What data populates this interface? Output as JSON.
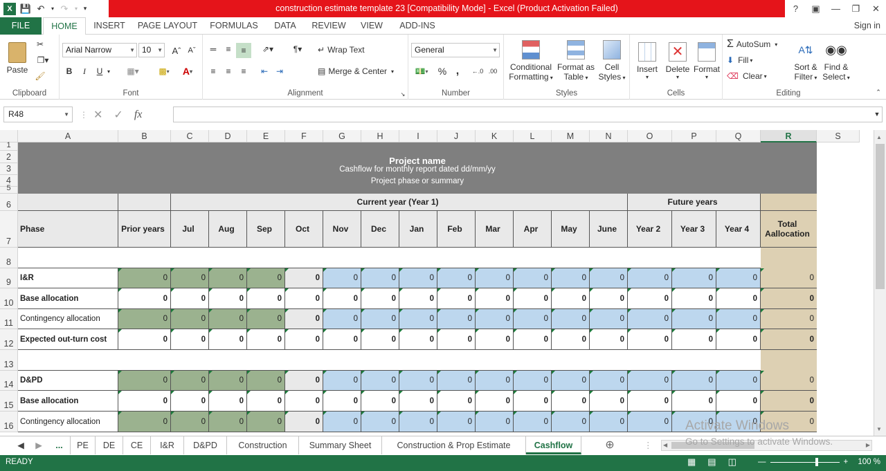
{
  "window": {
    "title": "construction estimate template 23  [Compatibility Mode] -  Excel (Product Activation Failed)",
    "help": "?",
    "sign_in": "Sign in"
  },
  "ribbon_tabs": [
    "FILE",
    "HOME",
    "INSERT",
    "PAGE LAYOUT",
    "FORMULAS",
    "DATA",
    "REVIEW",
    "VIEW",
    "ADD-INS"
  ],
  "ribbon": {
    "clipboard": {
      "label": "Clipboard",
      "paste": "Paste"
    },
    "font": {
      "label": "Font",
      "name": "Arial Narrow",
      "size": "10",
      "bold": "B",
      "italic": "I",
      "underline": "U"
    },
    "alignment": {
      "label": "Alignment",
      "wrap": "Wrap Text",
      "merge": "Merge & Center"
    },
    "number": {
      "label": "Number",
      "format": "General",
      "percent": "%",
      "comma": ","
    },
    "styles": {
      "label": "Styles",
      "conditional": "Conditional",
      "conditional2": "Formatting",
      "format_table": "Format as",
      "format_table2": "Table",
      "cell_styles": "Cell",
      "cell_styles2": "Styles"
    },
    "cells": {
      "label": "Cells",
      "insert": "Insert",
      "delete": "Delete",
      "format": "Format"
    },
    "editing": {
      "label": "Editing",
      "autosum": "AutoSum",
      "fill": "Fill",
      "clear": "Clear",
      "sort": "Sort &",
      "sort2": "Filter",
      "find": "Find &",
      "find2": "Select"
    }
  },
  "formula_bar": {
    "name_box": "R48",
    "fx": "fx",
    "value": ""
  },
  "columns": [
    "A",
    "B",
    "C",
    "D",
    "E",
    "F",
    "G",
    "H",
    "I",
    "J",
    "K",
    "L",
    "M",
    "N",
    "O",
    "P",
    "Q",
    "R",
    "S"
  ],
  "rows": [
    "1",
    "2",
    "3",
    "4",
    "5",
    "6",
    "7",
    "8",
    "9",
    "10",
    "11",
    "12",
    "13",
    "14",
    "15",
    "16"
  ],
  "sheet": {
    "project_name": "Project name",
    "subtitle": "Cashflow for monthly report dated dd/mm/yy",
    "phase_summary": "Project phase or summary",
    "current_year": "Current year (Year 1)",
    "future_years": "Future years",
    "headers": [
      "Phase",
      "Prior years",
      "Jul",
      "Aug",
      "Sep",
      "Oct",
      "Nov",
      "Dec",
      "Jan",
      "Feb",
      "Mar",
      "Apr",
      "May",
      "June",
      "Year 2",
      "Year 3",
      "Year 4",
      "Total Aallocation"
    ],
    "row_labels": {
      "r9": "I&R",
      "r10": "Base allocation",
      "r11": "Contingency allocation",
      "r12": "Expected out-turn cost",
      "r14": "D&PD",
      "r15": "Base allocation",
      "r16": "Contingency allocation"
    },
    "zero": "0"
  },
  "sheet_tabs": [
    "...",
    "PE",
    "DE",
    "CE",
    "I&R",
    "D&PD",
    "Construction",
    "Summary Sheet",
    "Construction & Prop Estimate",
    "Cashflow"
  ],
  "active_sheet": "Cashflow",
  "watermark": {
    "line1": "Activate Windows",
    "line2": "Go to Settings to activate Windows."
  },
  "status": {
    "ready": "READY",
    "zoom": "100 %"
  },
  "colors": {
    "excel_green": "#217346",
    "title_red": "#e5141a",
    "header_gray": "#7f7f7f",
    "green_fill": "#9bb28f",
    "blue_fill": "#bdd7ee",
    "tan_fill": "#ddd0b3",
    "light_gray": "#e9e9e9"
  }
}
